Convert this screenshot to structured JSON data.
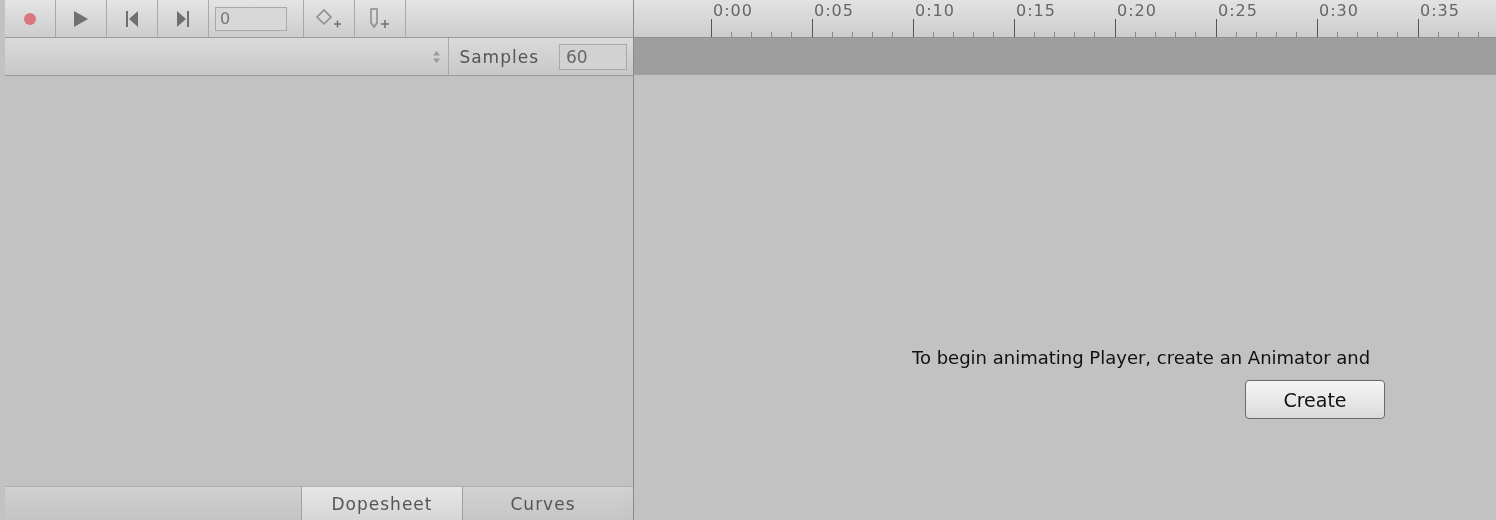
{
  "toolbar": {
    "frame": "0"
  },
  "samples": {
    "label": "Samples",
    "value": "60"
  },
  "ruler": {
    "labels": [
      "0:00",
      "0:05",
      "0:10",
      "0:15",
      "0:20",
      "0:25",
      "0:30",
      "0:35"
    ]
  },
  "message": "To begin animating Player, create an Animator and",
  "create_button": "Create",
  "tabs": [
    {
      "label": "Dopesheet",
      "selected": true
    },
    {
      "label": "Curves",
      "selected": false
    }
  ]
}
